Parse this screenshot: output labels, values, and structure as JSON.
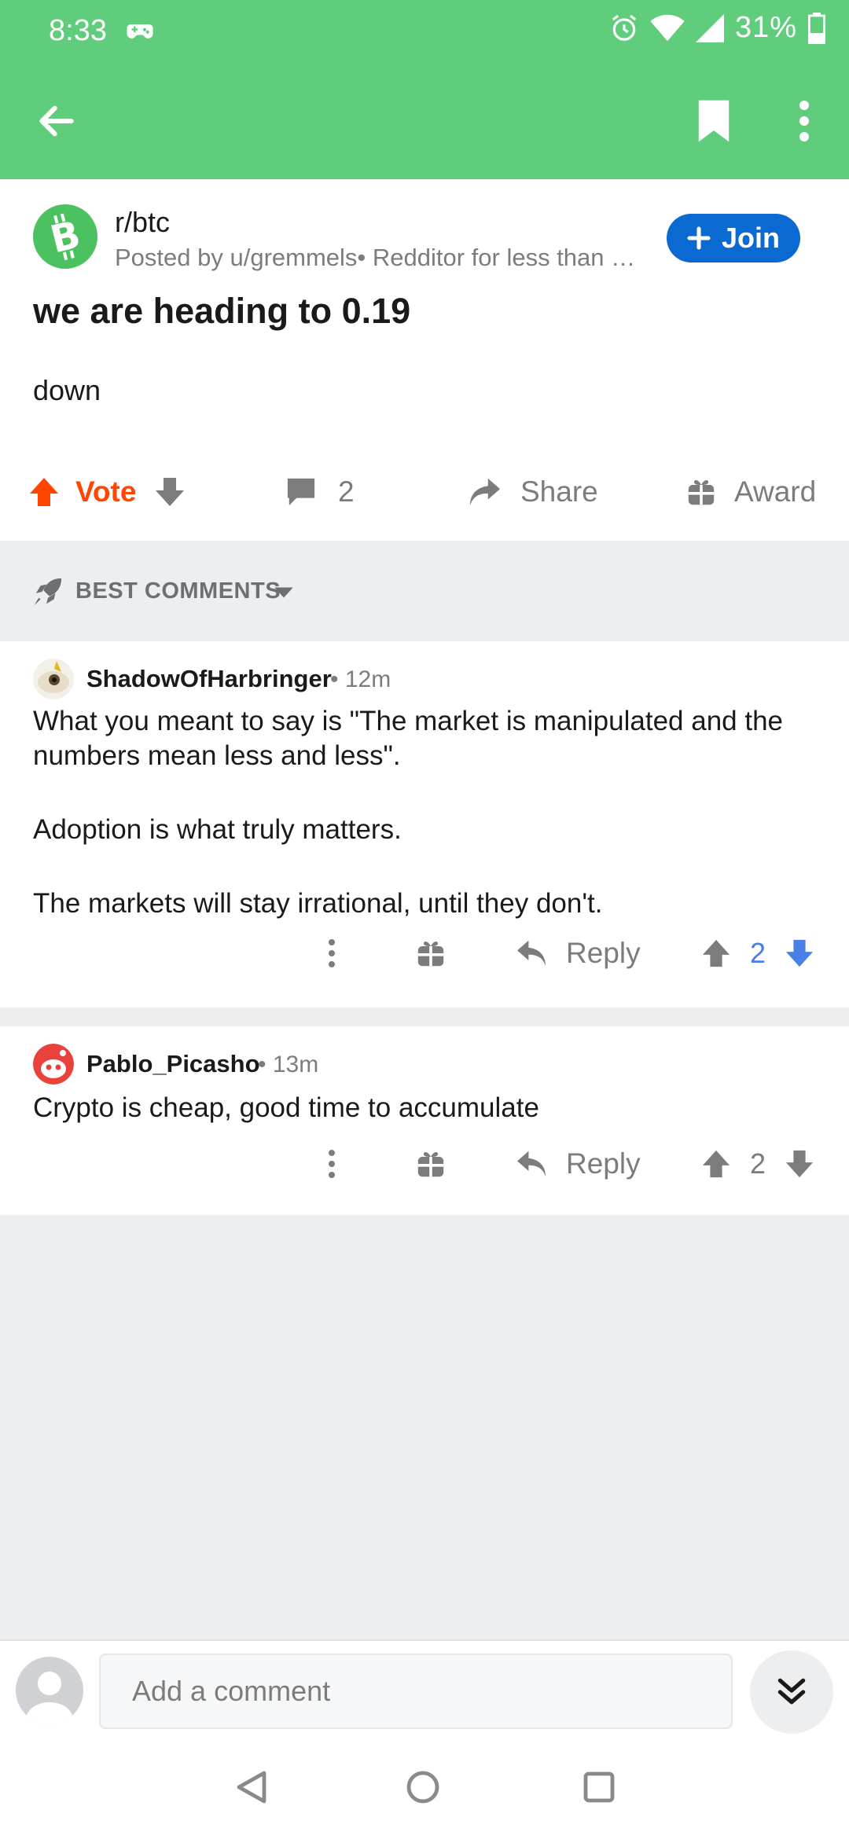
{
  "status_bar": {
    "time": "8:33",
    "battery_percent": "31%",
    "icons": [
      "game-controller-icon",
      "alarm-icon",
      "wifi-icon",
      "cell-signal-icon",
      "battery-icon"
    ]
  },
  "app_bar": {
    "icons": [
      "back-arrow-icon",
      "bookmark-icon",
      "more-vertical-icon"
    ],
    "background": "#5fcd7b"
  },
  "post": {
    "subreddit": "r/btc",
    "posted_by": "Posted by u/gremmels• Redditor for less than …",
    "join_label": "Join",
    "title": "we are heading to 0.19",
    "body": "down",
    "vote_label": "Vote",
    "comment_count": "2",
    "share_label": "Share",
    "award_label": "Award",
    "accent": "#ff4500",
    "join_color": "#0b6ad2"
  },
  "sort": {
    "label": "BEST COMMENTS"
  },
  "comments": [
    {
      "author": "ShadowOfHarbringer",
      "time": "• 12m",
      "paragraphs": [
        "What you meant to say is \"The market is manipulated and the numbers mean less and less\".",
        "Adoption is what truly matters.",
        "The markets will stay irrational, until they don't."
      ],
      "reply_label": "Reply",
      "score": "2",
      "score_color": "#4a7fe8"
    },
    {
      "author": "Pablo_Picasho",
      "time": "• 13m",
      "paragraphs": [
        "Crypto is cheap, good time to accumulate"
      ],
      "reply_label": "Reply",
      "score": "2",
      "score_color": "#7c7c7c"
    }
  ],
  "comment_bar": {
    "placeholder": "Add a comment"
  },
  "nav_bar": {
    "icons": [
      "nav-back-icon",
      "nav-home-icon",
      "nav-recents-icon"
    ]
  }
}
